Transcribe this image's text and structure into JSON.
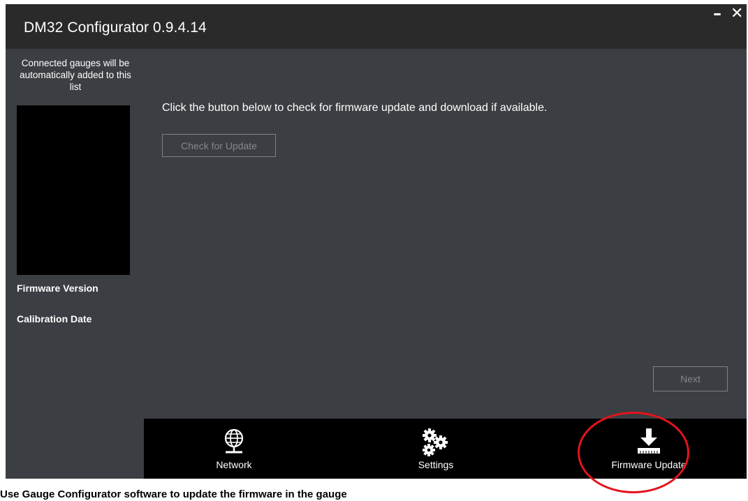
{
  "window": {
    "title": "DM32 Configurator 0.9.4.14",
    "minimize_glyph": "–",
    "close_glyph": "✕"
  },
  "sidebar": {
    "hint": "Connected gauges will be automatically added to this list",
    "firmware_version_label": "Firmware Version",
    "calibration_date_label": "Calibration Date"
  },
  "main": {
    "instructions": "Click the button below to check for firmware update and download if available.",
    "check_button_label": "Check for Update",
    "next_button_label": "Next"
  },
  "navbar": {
    "items": [
      {
        "label": "Network",
        "icon": "globe-network-icon"
      },
      {
        "label": "Settings",
        "icon": "gears-icon"
      },
      {
        "label": "Firmware Update",
        "icon": "download-tray-icon"
      }
    ]
  },
  "annotation": {
    "highlight_color": "#e3141c",
    "caption": "Use Gauge Configurator software to update the firmware in the gauge"
  },
  "colors": {
    "window_bg": "#3b3e42",
    "titlebar_bg": "#2a2a2a",
    "navbar_bg": "#000000",
    "disabled_text": "#84878c"
  }
}
